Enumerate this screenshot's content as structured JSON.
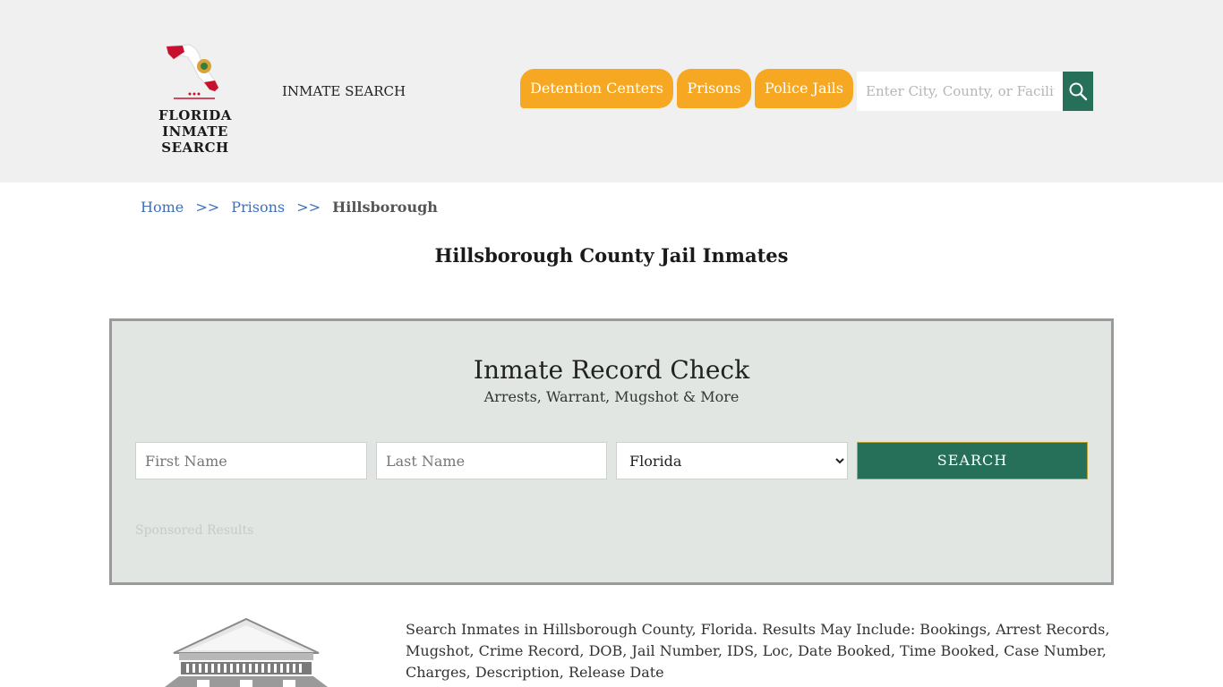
{
  "header": {
    "logo_line1": "FLORIDA",
    "logo_line2": "INMATE SEARCH",
    "site_title": "INMATE SEARCH",
    "nav": [
      {
        "label": "Detention Centers"
      },
      {
        "label": "Prisons"
      },
      {
        "label": "Police Jails"
      }
    ],
    "search_placeholder": "Enter City, County, or Facility",
    "accent_color": "#f7a823",
    "brand_color": "#26705a"
  },
  "breadcrumb": {
    "home": "Home",
    "sep": ">>",
    "prisons": "Prisons",
    "current": "Hillsborough"
  },
  "page_title": "Hillsborough County Jail Inmates",
  "record_check": {
    "title": "Inmate Record Check",
    "subtitle": "Arrests, Warrant, Mugshot & More",
    "first_name_placeholder": "First Name",
    "last_name_placeholder": "Last Name",
    "state_selected": "Florida",
    "search_label": "SEARCH",
    "sponsored": "Sponsored Results"
  },
  "description": "Search Inmates in Hillsborough County, Florida. Results May Include: Bookings, Arrest Records, Mugshot, Crime Record, DOB, Jail Number, IDS, Loc, Date Booked, Time Booked, Case Number, Charges, Description, Release Date",
  "icons": {
    "logo": "florida-map-icon",
    "search": "magnifier-icon",
    "building": "courthouse-icon"
  }
}
